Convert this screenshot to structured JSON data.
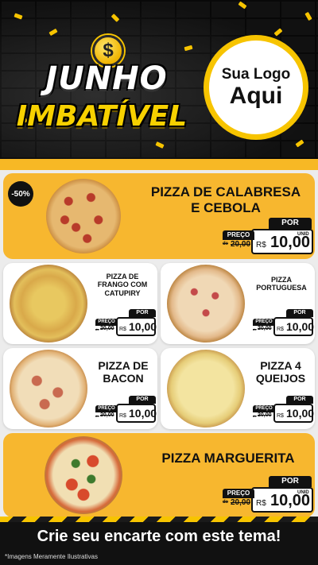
{
  "header": {
    "coin_symbol": "$",
    "title_line1": "JUNHO",
    "title_line2": "IMBATÍVEL",
    "logo_line1": "Sua Logo",
    "logo_line2": "Aqui"
  },
  "colors": {
    "accent": "#f7b72f",
    "dark": "#111111",
    "yellow": "#f7c400"
  },
  "featured": {
    "discount_badge": "-50%",
    "name_line1": "PIZZA DE CALABRESA",
    "name_line2": "E CEBOLA",
    "icon": "pizza-calabresa-image",
    "price": {
      "por": "POR",
      "preco_label": "PREÇO",
      "de": "de",
      "old": "20,00",
      "currency": "R$",
      "value": "10,00",
      "unit": "UNID"
    }
  },
  "grid": [
    {
      "name_line1": "PIZZA DE",
      "name_line2": "FRANGO COM",
      "name_line3": "CATUPIRY",
      "icon": "pizza-frango-image",
      "price": {
        "por": "POR",
        "preco_label": "PREÇO",
        "de": "de",
        "old": "20,00",
        "currency": "R$",
        "value": "10,00",
        "unit": "UNID"
      }
    },
    {
      "name_line1": "PIZZA",
      "name_line2": "PORTUGUESA",
      "icon": "pizza-portuguesa-image",
      "price": {
        "por": "POR",
        "preco_label": "PREÇO",
        "de": "de",
        "old": "20,00",
        "currency": "R$",
        "value": "10,00",
        "unit": "UNID"
      }
    },
    {
      "name_line1": "PIZZA DE",
      "name_line2": "BACON",
      "icon": "pizza-bacon-image",
      "price": {
        "por": "POR",
        "preco_label": "PREÇO",
        "de": "de",
        "old": "20,00",
        "currency": "R$",
        "value": "10,00",
        "unit": "UNID"
      }
    },
    {
      "name_line1": "PIZZA 4",
      "name_line2": "QUEIJOS",
      "icon": "pizza-queijos-image",
      "price": {
        "por": "POR",
        "preco_label": "PREÇO",
        "de": "de",
        "old": "20,00",
        "currency": "R$",
        "value": "10,00",
        "unit": "UNID"
      }
    }
  ],
  "bottom_featured": {
    "name": "PIZZA MARGUERITA",
    "icon": "pizza-marguerita-image",
    "price": {
      "por": "POR",
      "preco_label": "PREÇO",
      "de": "de",
      "old": "20,00",
      "currency": "R$",
      "value": "10,00",
      "unit": "UNID"
    }
  },
  "footer": {
    "cta": "Crie seu encarte com este tema!",
    "disclaimer": "*Imagens Meramente Ilustrativas"
  }
}
